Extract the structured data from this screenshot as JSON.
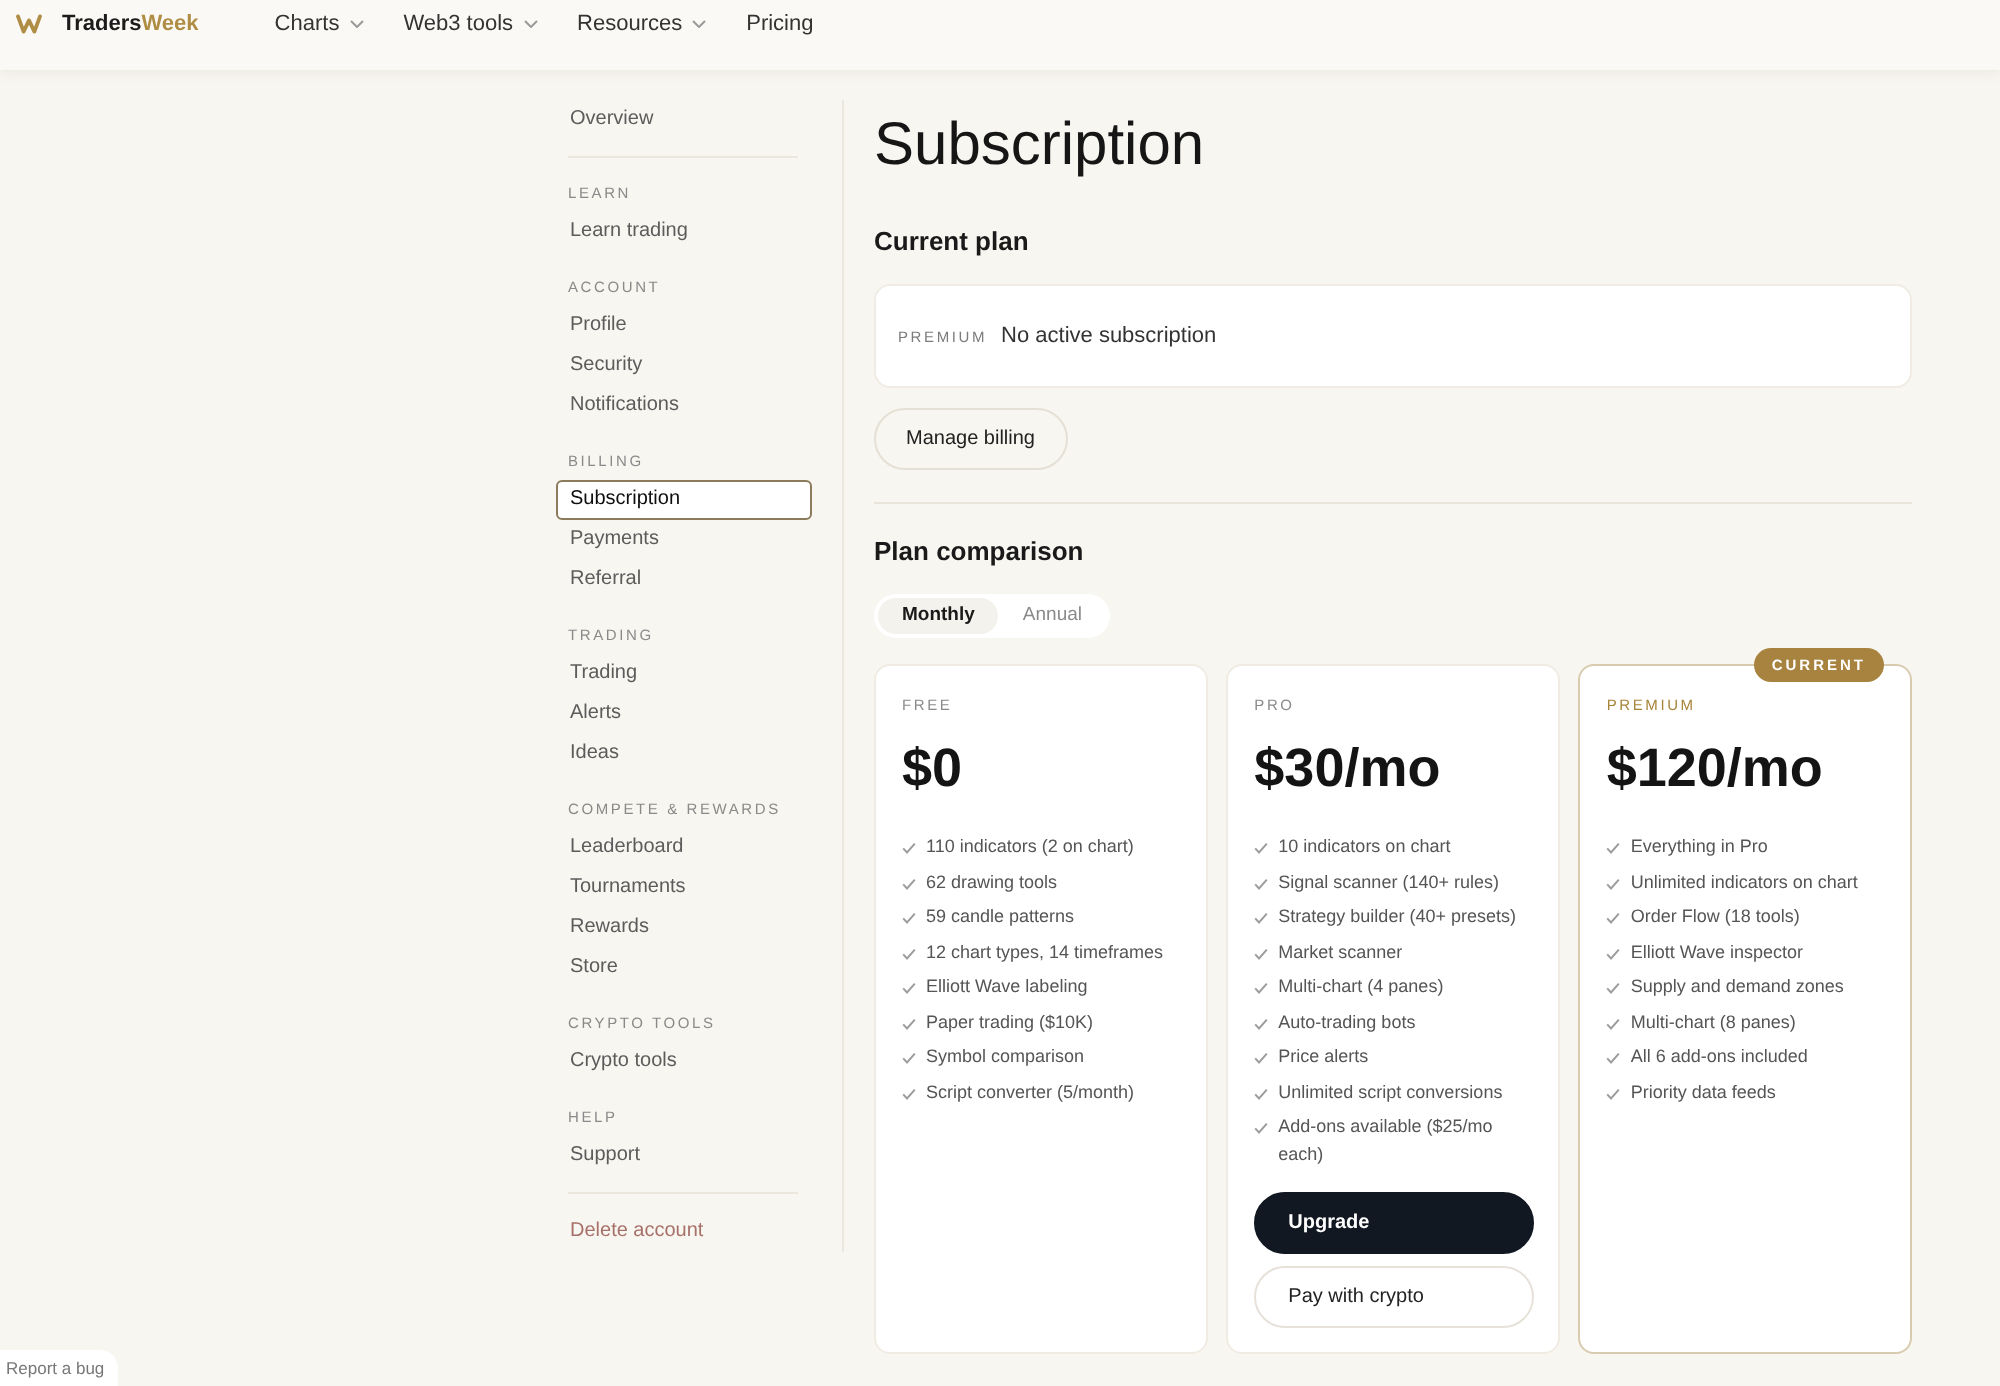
{
  "header": {
    "brand": {
      "name": "Traders",
      "name_accent": "Week"
    },
    "nav": [
      {
        "label": "Charts",
        "dropdown": true
      },
      {
        "label": "Web3 tools",
        "dropdown": true
      },
      {
        "label": "Resources",
        "dropdown": true
      },
      {
        "label": "Pricing",
        "dropdown": false
      }
    ]
  },
  "sidebar": {
    "top_items": [
      {
        "label": "Overview",
        "selected": false
      }
    ],
    "sections": [
      {
        "heading": "LEARN",
        "items": [
          {
            "label": "Learn trading",
            "selected": false
          }
        ]
      },
      {
        "heading": "ACCOUNT",
        "items": [
          {
            "label": "Profile",
            "selected": false
          },
          {
            "label": "Security",
            "selected": false
          },
          {
            "label": "Notifications",
            "selected": false
          }
        ]
      },
      {
        "heading": "BILLING",
        "items": [
          {
            "label": "Subscription",
            "selected": true
          },
          {
            "label": "Payments",
            "selected": false
          },
          {
            "label": "Referral",
            "selected": false
          }
        ]
      },
      {
        "heading": "TRADING",
        "items": [
          {
            "label": "Trading",
            "selected": false
          },
          {
            "label": "Alerts",
            "selected": false
          },
          {
            "label": "Ideas",
            "selected": false
          }
        ]
      },
      {
        "heading": "COMPETE & REWARDS",
        "items": [
          {
            "label": "Leaderboard",
            "selected": false
          },
          {
            "label": "Tournaments",
            "selected": false
          },
          {
            "label": "Rewards",
            "selected": false
          },
          {
            "label": "Store",
            "selected": false
          }
        ]
      },
      {
        "heading": "CRYPTO TOOLS",
        "items": [
          {
            "label": "Crypto tools",
            "selected": false
          }
        ]
      },
      {
        "heading": "HELP",
        "items": [
          {
            "label": "Support",
            "selected": false
          }
        ]
      }
    ],
    "bottom_items": [
      {
        "label": "Delete account",
        "selected": false,
        "kind": "danger"
      }
    ]
  },
  "page": {
    "title": "Subscription",
    "current_plan": {
      "heading": "Current plan",
      "tier": "PREMIUM",
      "status": "No active subscription",
      "button": "Manage billing"
    },
    "plan_comparison": {
      "heading": "Plan comparison",
      "billing_period": [
        {
          "label": "Monthly",
          "selected": true
        },
        {
          "label": "Annual",
          "selected": false
        }
      ],
      "plans": [
        {
          "tier": "FREE",
          "price": "$0",
          "current": false,
          "features": [
            "110 indicators (2 on chart)",
            "62 drawing tools",
            "59 candle patterns",
            "12 chart types, 14 timeframes",
            "Elliott Wave labeling",
            "Paper trading ($10K)",
            "Symbol comparison",
            "Script converter (5/month)"
          ]
        },
        {
          "tier": "PRO",
          "price": "$30/mo",
          "current": false,
          "features": [
            "10 indicators on chart",
            "Signal scanner (140+ rules)",
            "Strategy builder (40+ presets)",
            "Market scanner",
            "Multi-chart (4 panes)",
            "Auto-trading bots",
            "Price alerts",
            "Unlimited script conversions",
            "Add-ons available ($25/mo each)"
          ],
          "buttons": [
            {
              "label": "Upgrade",
              "kind": "primary"
            },
            {
              "label": "Pay with crypto",
              "kind": "secondary"
            }
          ]
        },
        {
          "tier": "PREMIUM",
          "price": "$120/mo",
          "current": true,
          "badge": "CURRENT",
          "features": [
            "Everything in Pro",
            "Unlimited indicators on chart",
            "Order Flow (18 tools)",
            "Elliott Wave inspector",
            "Supply and demand zones",
            "Multi-chart (8 panes)",
            "All 6 add-ons included",
            "Priority data feeds"
          ]
        }
      ]
    }
  },
  "report_bug": {
    "label": "Report a bug"
  }
}
